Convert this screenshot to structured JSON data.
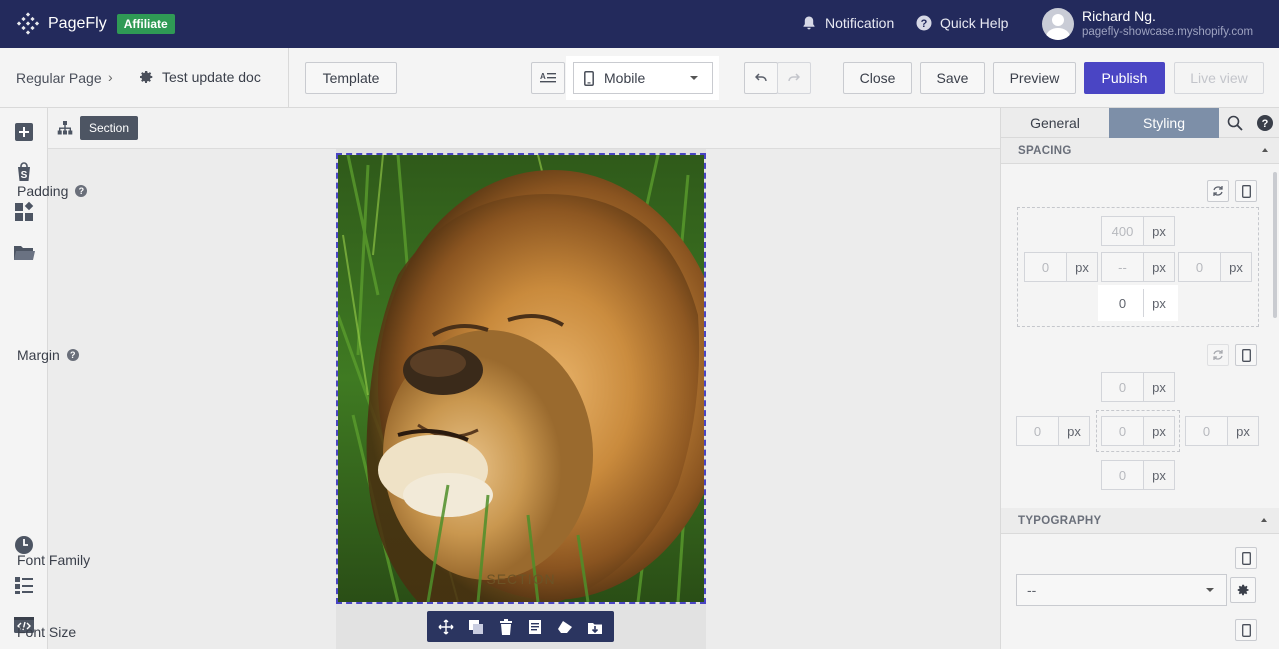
{
  "app": {
    "brand": "PageFly",
    "badge": "Affiliate",
    "notification": "Notification",
    "quick_help": "Quick Help",
    "user_name": "Richard Ng.",
    "user_store": "pagefly-showcase.myshopify.com"
  },
  "toolbar": {
    "breadcrumb": "Regular Page",
    "breadcrumb_sep": "›",
    "doc_title": "Test update doc",
    "template": "Template",
    "device": "Mobile",
    "close": "Close",
    "save": "Save",
    "preview": "Preview",
    "publish": "Publish",
    "live_view": "Live view"
  },
  "canvas": {
    "selected_tag": "Section",
    "section_label": "SECTION"
  },
  "panel": {
    "tabs": [
      "General",
      "Styling"
    ],
    "active_tab": "Styling",
    "spacing_title": "SPACING",
    "padding_label": "Padding",
    "padding": {
      "top": "400",
      "left": "0",
      "center": "--",
      "right": "0",
      "bottom": "0",
      "unit": "px"
    },
    "margin_label": "Margin",
    "margin": {
      "top": "0",
      "left": "0",
      "center": "0",
      "right": "0",
      "bottom": "0",
      "unit": "px"
    },
    "typography_title": "TYPOGRAPHY",
    "font_family_label": "Font Family",
    "font_family_value": "--",
    "font_size_label": "Font Size",
    "help_glyph": "?"
  },
  "colors": {
    "topbar": "#232a5c",
    "accent": "#4a45c4",
    "affiliate": "#2f9a55",
    "active_tab": "#7d8fa8"
  }
}
